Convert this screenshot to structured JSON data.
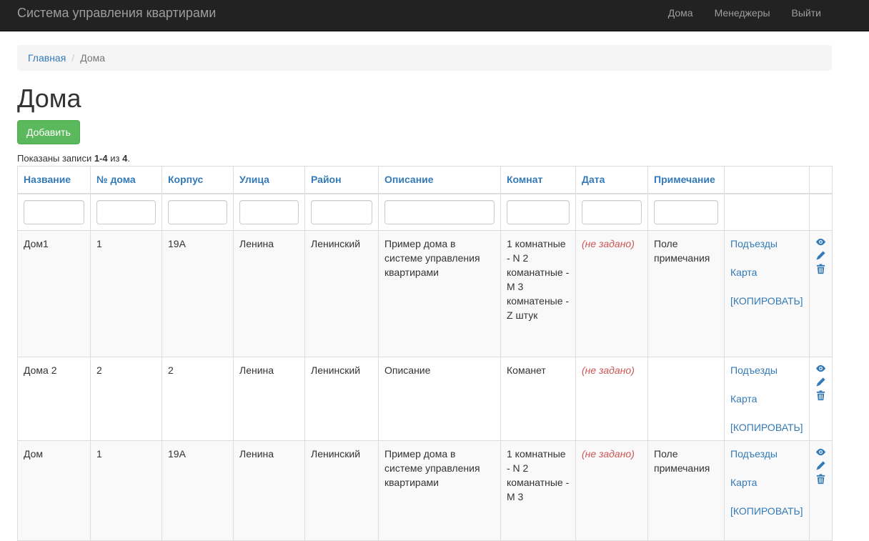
{
  "navbar": {
    "brand": "Система управления квартирами",
    "links": [
      "Дома",
      "Менеджеры",
      "Выйти"
    ]
  },
  "breadcrumb": {
    "home": "Главная",
    "current": "Дома"
  },
  "page": {
    "title": "Дома",
    "add_label": "Добавить",
    "summary_prefix": "Показаны записи ",
    "summary_range": "1-4",
    "summary_mid": " из ",
    "summary_total": "4",
    "summary_suffix": "."
  },
  "table": {
    "headers": [
      "Название",
      "№ дома",
      "Корпус",
      "Улица",
      "Район",
      "Описание",
      "Комнат",
      "Дата",
      "Примечание"
    ],
    "not_set_label": "(не задано)",
    "link_labels": [
      "Подъезды",
      "Карта",
      "[КОПИРОВАТЬ]"
    ],
    "action_icons": [
      "eye-icon",
      "pencil-icon",
      "trash-icon"
    ],
    "rows": [
      {
        "name": "Дом1",
        "number": "1",
        "building": "19А",
        "street": "Ленина",
        "district": "Ленинский",
        "description": "Пример дома в системе управления квартирами",
        "rooms": "1 комнатные - N 2 команатные - M 3 комнатеные - Z штук",
        "date": "(не задано)",
        "note": "Поле примечания"
      },
      {
        "name": "Дома 2",
        "number": "2",
        "building": "2",
        "street": "Ленина",
        "district": "Ленинский",
        "description": "Описание",
        "rooms": "Команет",
        "date": "(не задано)",
        "note": ""
      },
      {
        "name": "Дом",
        "number": "1",
        "building": "19А",
        "street": "Ленина",
        "district": "Ленинский",
        "description": "Пример дома в системе управления квартирами",
        "rooms": "1 комнатные - N 2 команатные - M 3",
        "date": "(не задано)",
        "note": "Поле примечания"
      }
    ]
  },
  "colors": {
    "navbar_bg": "#222222",
    "link": "#337ab7",
    "success": "#5cb85c",
    "not_set": "#cc5555"
  }
}
